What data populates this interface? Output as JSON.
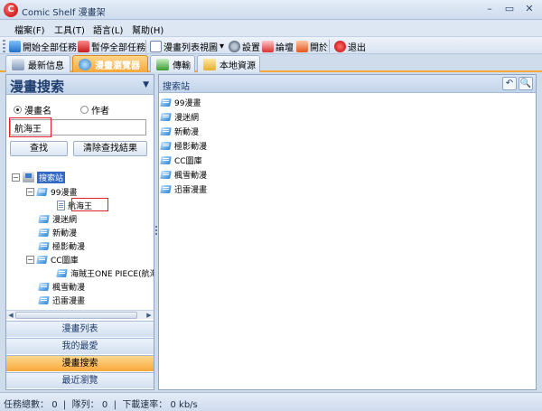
{
  "window": {
    "title": "Comic  Shelf 漫畫架",
    "logo": "C"
  },
  "window_controls": {
    "minimize": "–",
    "maximize": "▭",
    "close": "✕"
  },
  "menu": [
    "檔案(F)",
    "工具(T)",
    "語言(L)",
    "幫助(H)"
  ],
  "toolbar": {
    "start_all": "開始全部任務",
    "pause_all": "暫停全部任務",
    "list_view": "漫畫列表視圖",
    "settings": "設置",
    "forum": "論壇",
    "donate": "開於",
    "exit": "退出"
  },
  "tabs": [
    "最新信息",
    "漫畫瀏覽器",
    "傳輸",
    "本地資源"
  ],
  "left_panel": {
    "title": "漫畫搜索",
    "menu_glyph": "▼",
    "radio_name": "漫畫名",
    "radio_author": "作者",
    "search_value": "航海王",
    "search_button": "查找",
    "clear_button": "清除查找結果",
    "tree": {
      "root": "搜索站",
      "items": [
        {
          "label": "99漫畫",
          "expanded": true,
          "children": [
            "航海王"
          ]
        },
        {
          "label": "漫迷網"
        },
        {
          "label": "新動漫"
        },
        {
          "label": "極影動漫"
        },
        {
          "label": "CC圖庫",
          "expanded": true,
          "children": [
            "海賊王ONE PIECE(航海"
          ]
        },
        {
          "label": "楓雪動漫"
        },
        {
          "label": "迅雷漫畫"
        }
      ]
    },
    "scroll_left": "◀",
    "scroll_right": "▶",
    "nav": [
      "漫畫列表",
      "我的最愛",
      "漫畫搜索",
      "最近瀏覽"
    ]
  },
  "right_panel": {
    "title": "搜索站",
    "sites": [
      "99漫畫",
      "漫迷網",
      "新動漫",
      "極影動漫",
      "CC圖庫",
      "楓雪動漫",
      "迅雷漫畫"
    ],
    "icons": {
      "back": "↶",
      "search": "🔍"
    }
  },
  "status": {
    "total_label": "任務總數：",
    "total": "0",
    "queue_label": "隊列：",
    "queue": "0",
    "speed_label": "下載速率：",
    "speed": "0 kb/s"
  },
  "colors": {
    "accent": "#f8a73a",
    "selection": "#3169c6",
    "highlight_box": "#e0202a"
  }
}
